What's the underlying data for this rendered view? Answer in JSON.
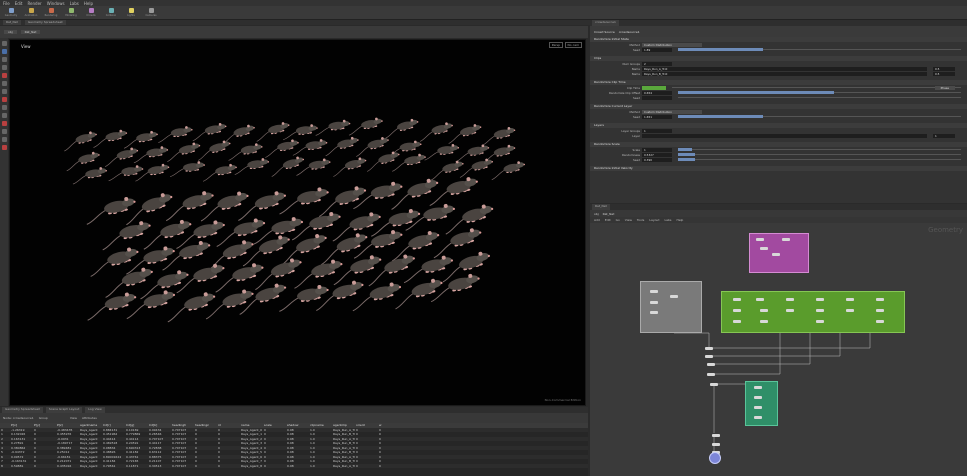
{
  "menubar": {
    "items": [
      "File",
      "Edit",
      "Render",
      "Windows",
      "Labs",
      "Help"
    ]
  },
  "shelf": {
    "tools": [
      {
        "label": "Geometry",
        "color": "#7f9ecb"
      },
      {
        "label": "Animation",
        "color": "#c9a64a"
      },
      {
        "label": "Rendering",
        "color": "#c96a4a"
      },
      {
        "label": "Modeling",
        "color": "#8fb86d"
      },
      {
        "label": "Crowds",
        "color": "#b57cc4"
      },
      {
        "label": "Collision",
        "color": "#6ab0b4"
      },
      {
        "label": "Lights",
        "color": "#e0d060"
      },
      {
        "label": "Cameras",
        "color": "#9a9a9a"
      }
    ]
  },
  "viewport": {
    "crumb_obj": "obj",
    "crumb_node": "Rat_Net",
    "label": "View",
    "persp": "Persp",
    "cam": "No cam",
    "footer_note": "Non-Commercial Edition"
  },
  "params": {
    "node_type": "Crowd Source",
    "node_name": "crowdsource1",
    "sections": [
      {
        "title": "Randomize Initial State",
        "rows": [
          {
            "label": "Method",
            "kind": "menu",
            "value": "Custom Distribution"
          },
          {
            "label": "Seed",
            "kind": "slider",
            "value": "1.89",
            "fill": 0.3
          }
        ]
      },
      {
        "title": "Clips",
        "rows": [
          {
            "label": "Num Groups",
            "kind": "value",
            "value": "2"
          },
          {
            "label": "Name",
            "kind": "wide",
            "value": "Rays_Run_A_Trot",
            "weight": "0.5"
          },
          {
            "label": "Name",
            "kind": "wide",
            "value": "Rays_Run_B_Trot",
            "weight": "0.5"
          }
        ]
      },
      {
        "title": "Randomize Clip Time",
        "rows": [
          {
            "label": "Clip Time",
            "kind": "color",
            "btn": "Phase"
          },
          {
            "label": "Randomize Clip Offset",
            "kind": "slider",
            "value": "0.654",
            "fill": 0.55
          },
          {
            "label": "Seed",
            "kind": "slider",
            "value": "",
            "fill": 0.0
          }
        ]
      },
      {
        "title": "Randomize Current Layer",
        "rows": [
          {
            "label": "Method",
            "kind": "menu",
            "value": "Custom Distribution"
          },
          {
            "label": "Seed",
            "kind": "slider",
            "value": "1.651",
            "fill": 0.3
          }
        ]
      },
      {
        "title": "Layers",
        "rows": [
          {
            "label": "Layer Groups",
            "kind": "value",
            "value": "1"
          },
          {
            "label": "Layer",
            "kind": "wide",
            "value": "",
            "weight": "1"
          }
        ]
      },
      {
        "title": "Randomize Scale",
        "rows": [
          {
            "label": "Scale",
            "kind": "slider",
            "value": "1",
            "fill": 0.05
          },
          {
            "label": "Randomness",
            "kind": "slider",
            "value": "0.5327",
            "fill": 0.06
          },
          {
            "label": "Seed",
            "kind": "slider",
            "value": "0.390",
            "fill": 0.06
          }
        ]
      },
      {
        "title": "Randomize Initial Velocity",
        "rows": []
      }
    ]
  },
  "network": {
    "crumb_obj": "obj",
    "crumb_node": "Rat_Net",
    "menu": [
      "Add",
      "Edit",
      "Go",
      "View",
      "Tools",
      "Layout",
      "Labs",
      "Help"
    ],
    "context_label": "Geometry"
  },
  "spreadsheet": {
    "tabs": [
      "Geometry Spreadsheet",
      "Scene Graph Layout",
      "Log View"
    ],
    "node_label": "Node: crowdsource1",
    "group_label": "Group",
    "view_label": "View",
    "attributes_label": "Attributes",
    "columns": [
      "",
      "P[x]",
      "P[y]",
      "P[z]",
      "agentname",
      "Cd[r]",
      "Cd[g]",
      "Cd[b]",
      "headingh",
      "headingz",
      "id",
      "name",
      "scale",
      "shadow",
      "clipname",
      "agentclip",
      "orient",
      "w"
    ],
    "rows": [
      [
        "0",
        "-1.26319",
        "0",
        "-0.483435",
        "Rays_Agent",
        "0.884131",
        "0.10169",
        "0.99434",
        "0.707107",
        "0",
        "0",
        "Rays_Agent_0",
        "0",
        "0.98",
        "1.0",
        "Rays_Run_A_Trot",
        "0",
        "0"
      ],
      [
        "1",
        "0.132026",
        "0",
        "0.455976",
        "Rays_Agent",
        "0.451962",
        "0.779869",
        "0.26546",
        "0.707107",
        "0",
        "0",
        "Rays_Agent_1",
        "0",
        "0.98",
        "1.0",
        "Rays_Run_B_Trot",
        "0",
        "0"
      ],
      [
        "2",
        "0.163131",
        "0",
        "-0.0931",
        "Rays_Agent",
        "0.44414",
        "0.44114",
        "0.707107",
        "0.707107",
        "0",
        "0",
        "Rays_Agent_2",
        "0",
        "0.98",
        "1.0",
        "Rays_Run_A_Trot",
        "0",
        "0"
      ],
      [
        "3",
        "0.27891",
        "0",
        "-0.189717",
        "Rays_Agent",
        "0.469518",
        "0.24591",
        "0.44117",
        "0.707107",
        "0",
        "0",
        "Rays_Agent_3",
        "0",
        "0.98",
        "1.0",
        "Rays_Run_B_Trot",
        "0",
        "0"
      ],
      [
        "4",
        "0.380862",
        "0",
        "0.389481",
        "Rays_Agent",
        "0.08834",
        "0.690313",
        "0.72838",
        "0.707107",
        "0",
        "0",
        "Rays_Agent_4",
        "0",
        "0.98",
        "1.0",
        "Rays_Run_A_Trot",
        "0",
        "0"
      ],
      [
        "5",
        "-0.94372",
        "0",
        "0.25012",
        "Rays_Agent",
        "0.48826",
        "0.41182",
        "0.63112",
        "0.707107",
        "0",
        "0",
        "Rays_Agent_5",
        "0",
        "0.98",
        "1.0",
        "Rays_Run_B_Trot",
        "0",
        "0"
      ],
      [
        "6",
        "0.09572",
        "0",
        "-0.66181",
        "Rays_Agent",
        "0.89001624",
        "0.43761",
        "0.88375",
        "0.707107",
        "0",
        "0",
        "Rays_Agent_6",
        "0",
        "0.98",
        "1.0",
        "Rays_Run_A_Trot",
        "0",
        "0"
      ],
      [
        "7",
        "-0.163131",
        "0",
        "0.212071",
        "Rays_Agent",
        "0.41184",
        "0.72165",
        "0.21107",
        "0.707107",
        "0",
        "0",
        "Rays_Agent_7",
        "0",
        "0.98",
        "1.0",
        "Rays_Run_B_Trot",
        "0",
        "0"
      ],
      [
        "8",
        "0.59881",
        "0",
        "0.435016",
        "Rays_Agent",
        "0.79561",
        "0.11871",
        "0.34513",
        "0.707107",
        "0",
        "0",
        "Rays_Agent_8",
        "0",
        "0.98",
        "1.0",
        "Rays_Run_A_Trot",
        "0",
        "0"
      ]
    ]
  }
}
